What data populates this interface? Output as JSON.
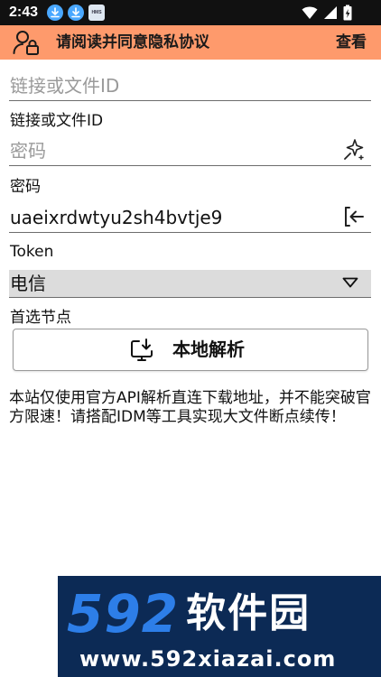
{
  "status_bar": {
    "time": "2:43",
    "badge_label": "HMS",
    "icons": [
      "download-icon",
      "download-icon",
      "hms-core-icon",
      "wifi-icon",
      "signal-icon",
      "battery-charging-icon"
    ]
  },
  "app_bar": {
    "title": "请阅读并同意隐私协议",
    "action": "查看",
    "background": "#fe9a6c"
  },
  "link_field": {
    "placeholder": "链接或文件ID",
    "label": "链接或文件ID"
  },
  "password_field": {
    "placeholder": "密码",
    "label": "密码",
    "icon": "sparkle-icon"
  },
  "token_field": {
    "value": "uaeixrdwtyu2sh4bvtje9",
    "label": "Token",
    "icon": "login-icon"
  },
  "node_select": {
    "selected": "电信",
    "label": "首选节点"
  },
  "parse_button": {
    "label": "本地解析",
    "icon": "download-monitor-icon"
  },
  "notice": "本站仅使用官方API解析直连下载地址，并不能突破官方限速！请搭配IDM等工具实现大文件断点续传！",
  "watermark": {
    "number": "592",
    "name": "软件园",
    "url": "www.592xiazai.com"
  }
}
